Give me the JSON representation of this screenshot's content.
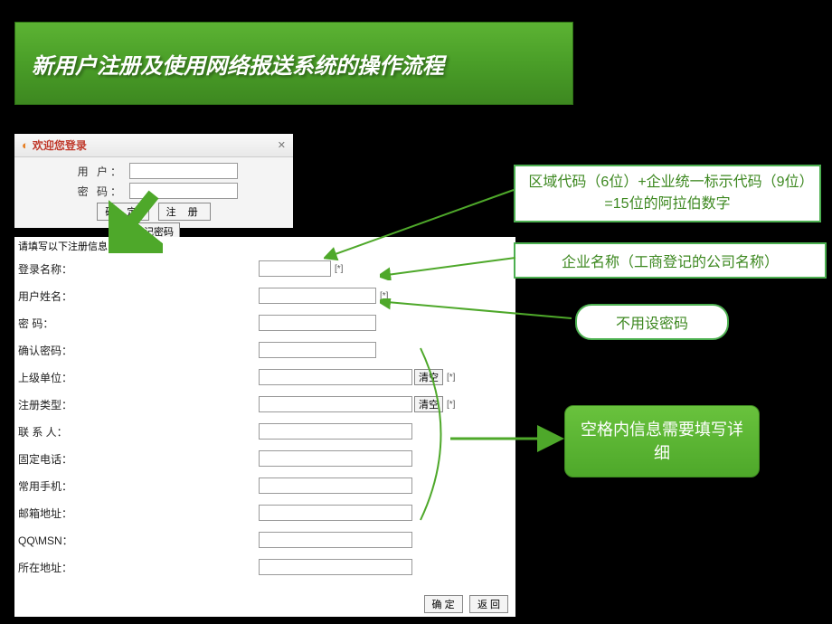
{
  "banner": {
    "title": "新用户注册及使用网络报送系统的操作流程"
  },
  "login": {
    "header": "欢迎您登录",
    "user_label": "用 户：",
    "pass_label": "密 码：",
    "ok_btn": "确 定",
    "register_btn": "注 册",
    "forgot_btn": "忘记密码"
  },
  "reg": {
    "header": "请填写以下注册信息：",
    "fields": {
      "login_name": "登录名称：",
      "user_name": "用户姓名：",
      "password": "密    码：",
      "confirm_pw": "确认密码：",
      "superior": "上级单位：",
      "reg_type": "注册类型：",
      "contact": "联 系 人：",
      "phone": "固定电话：",
      "mobile": "常用手机：",
      "email": "邮箱地址：",
      "qq": "QQ\\MSN：",
      "address": "所在地址："
    },
    "clear_btn": "清空",
    "marker": "[*]",
    "confirm_btn": "确 定",
    "back_btn": "返 回"
  },
  "callouts": {
    "c1": "区域代码（6位）+企业统一标示代码（9位）=15位的阿拉伯数字",
    "c2": "企业名称（工商登记的公司名称）",
    "c3": "不用设密码",
    "c4": "空格内信息需要填写详细"
  },
  "colors": {
    "green_primary": "#4ea82a",
    "green_border": "#4caf50",
    "green_text": "#3d8820"
  }
}
